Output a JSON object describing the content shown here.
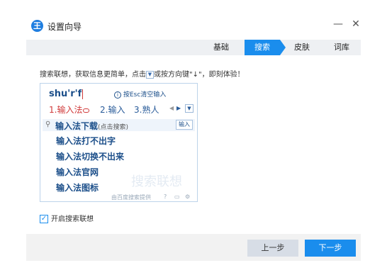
{
  "window": {
    "logo_glyph": "王",
    "title": "设置向导",
    "minimize_glyph": "—",
    "close_glyph": "✕"
  },
  "tabs": [
    {
      "label": "基础",
      "active": false
    },
    {
      "label": "搜索",
      "active": true
    },
    {
      "label": "皮肤",
      "active": false
    },
    {
      "label": "词库",
      "active": false
    }
  ],
  "description": {
    "part1": "搜索联想，获取信息更简单，点击",
    "part2": "或按方向键\"↓\"，即刻体验！"
  },
  "demo": {
    "pinyin": "shu'r'f",
    "tip": "按Esc清空输入",
    "candidates": [
      "1.输入法",
      "2.输入",
      "3.熟人"
    ],
    "search_main": "输入法下载",
    "search_hint": "(点击搜索)",
    "enter_label": "输入",
    "suggestions": [
      "输入法打不出字",
      "输入法切换不出来",
      "输入法官网",
      "输入法图标"
    ],
    "watermark": "搜索联想",
    "provider": "由百度搜索提供"
  },
  "option": {
    "label": "开启搜索联想",
    "checked": true
  },
  "footer": {
    "prev_label": "上一步",
    "next_label": "下一步"
  },
  "colors": {
    "accent": "#1a8ded",
    "candidate_highlight": "#d03a3a"
  }
}
